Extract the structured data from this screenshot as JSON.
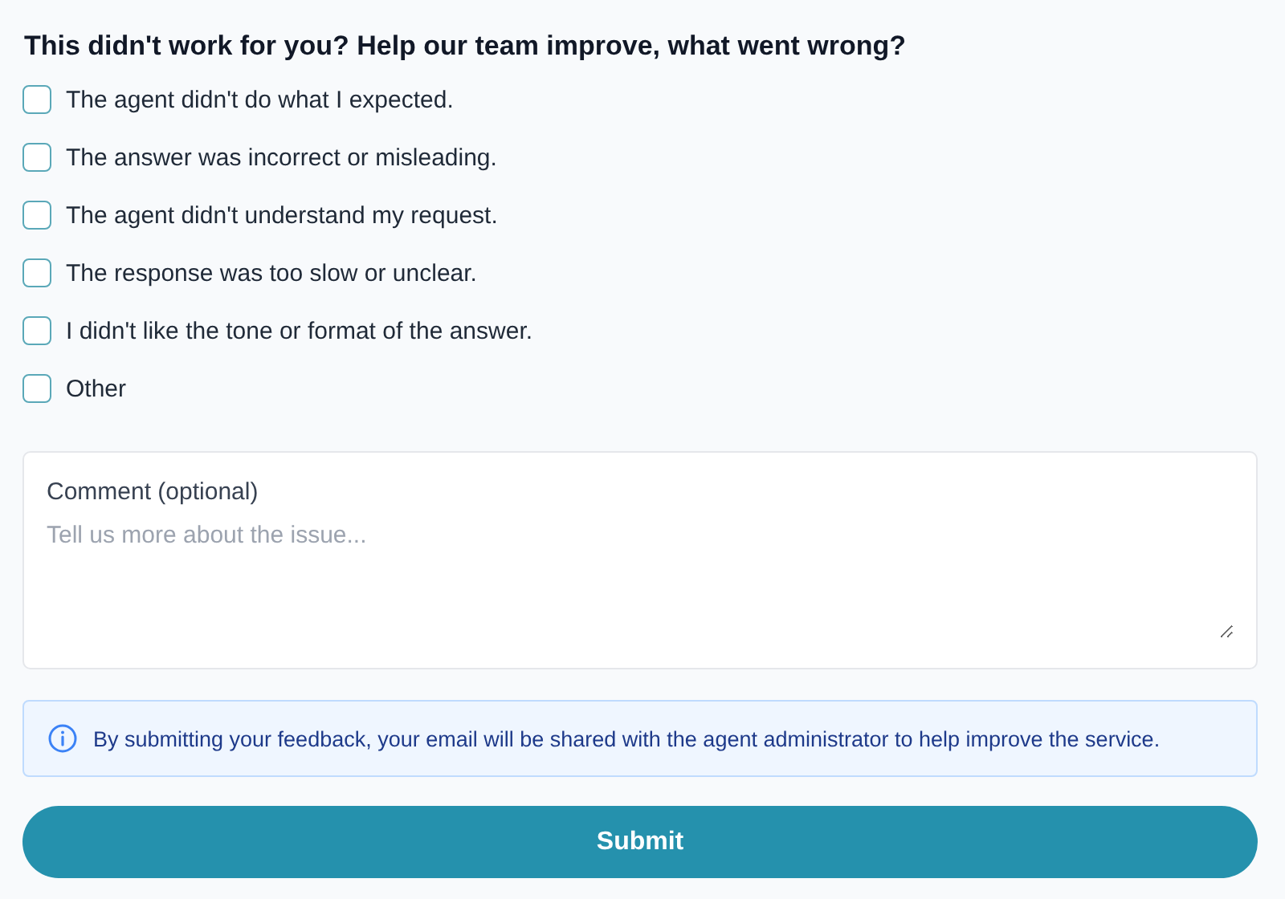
{
  "heading": "This didn't work for you? Help our team improve, what went wrong?",
  "options": [
    {
      "label": "The agent didn't do what I expected.",
      "checked": false
    },
    {
      "label": "The answer was incorrect or misleading.",
      "checked": false
    },
    {
      "label": "The agent didn't understand my request.",
      "checked": false
    },
    {
      "label": "The response was too slow or unclear.",
      "checked": false
    },
    {
      "label": "I didn't like the tone or format of the answer.",
      "checked": false
    },
    {
      "label": "Other",
      "checked": false
    }
  ],
  "comment": {
    "label": "Comment (optional)",
    "placeholder": "Tell us more about the issue..."
  },
  "notice": "By submitting your feedback, your email will be shared with the agent administrator to help improve the service.",
  "submit": "Submit"
}
